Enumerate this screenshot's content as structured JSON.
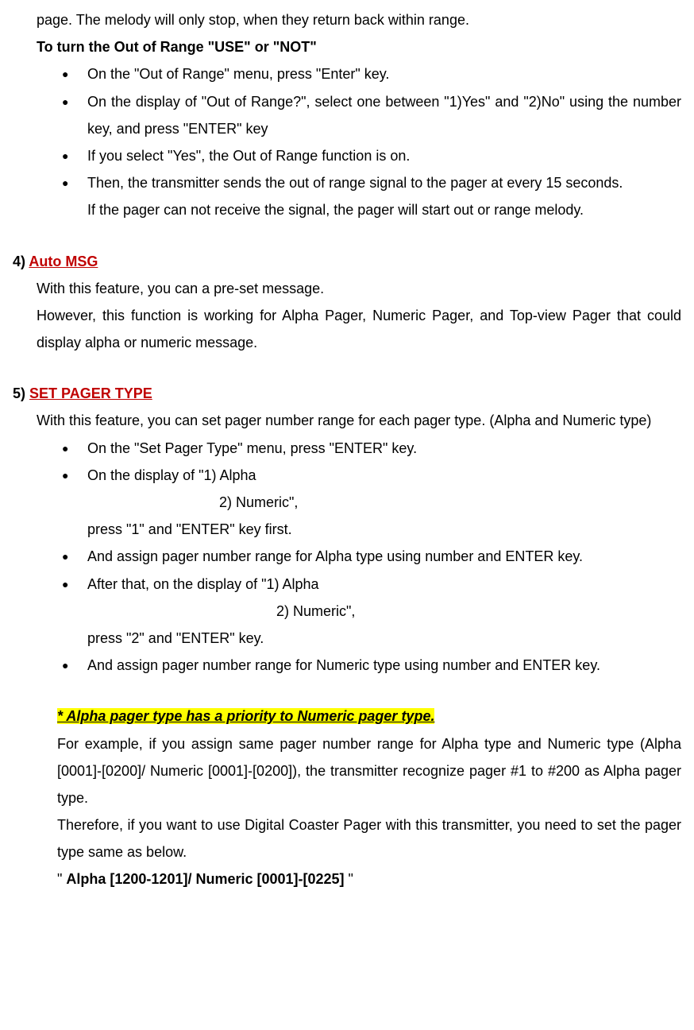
{
  "intro": {
    "line1": "page. The melody will only stop, when they return back within range.",
    "heading": "To turn the Out of Range \"USE\" or \"NOT\""
  },
  "bullets1": {
    "b1": "On the \"Out of Range\" menu, press \"Enter\" key.",
    "b2": "On the display of \"Out of Range?\", select one between \"1)Yes\" and \"2)No\" using the number key, and press \"ENTER\" key",
    "b3": "If you select \"Yes\", the Out of Range function is on.",
    "b4": "Then, the transmitter sends the out of range signal to the pager at every 15 seconds.",
    "b4cont": "If the pager can not receive the signal, the pager will start out or range melody."
  },
  "section4": {
    "num": "4) ",
    "title": "Auto MSG",
    "p1": "With this feature, you can a pre-set message.",
    "p2": "However, this function is working for Alpha Pager, Numeric Pager, and Top-view Pager that could display alpha or numeric message."
  },
  "section5": {
    "num": "5) ",
    "title": "SET PAGER TYPE",
    "p1": "With this feature, you can set pager number range for each pager type. (Alpha and Numeric type)"
  },
  "bullets5": {
    "b1": "On the \"Set Pager Type\" menu, press \"ENTER\" key.",
    "b2": "On the display of \"1) Alpha",
    "b2line2": "2) Numeric\",",
    "b2line3": "press \"1\" and \"ENTER\" key first.",
    "b3": "And assign pager number range for Alpha type using number and ENTER key.",
    "b4": "After that, on the display of \"1) Alpha",
    "b4line2": "2) Numeric\",",
    "b4line3": "press \"2\" and \"ENTER\" key.",
    "b5": "And assign pager number range for Numeric type using number and ENTER key."
  },
  "note": {
    "highlight": "* Alpha pager type has a priority to Numeric pager type.",
    "p1": "For example, if you assign same pager number range for Alpha type and Numeric type (Alpha [0001]-[0200]/ Numeric [0001]-[0200]), the transmitter recognize pager #1 to #200 as Alpha pager type.",
    "p2": "Therefore, if you want to use Digital Coaster Pager with this transmitter, you need to set the pager type same as below.",
    "p3pre": "\" ",
    "p3bold": "Alpha [1200-1201]/ Numeric [0001]-[0225]",
    "p3post": " \""
  },
  "bulletChar": "●"
}
